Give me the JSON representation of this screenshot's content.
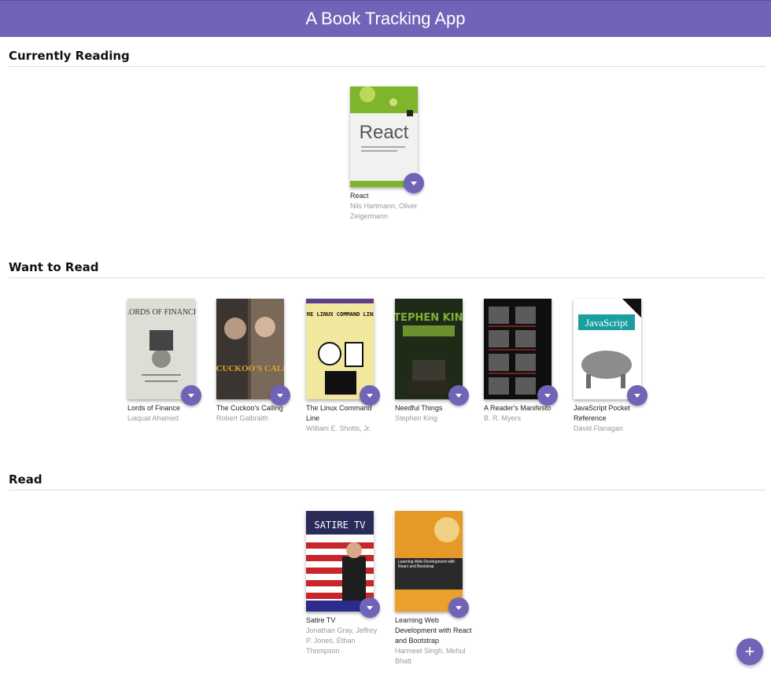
{
  "app": {
    "title": "A Book Tracking App"
  },
  "shelves": [
    {
      "title": "Currently Reading",
      "books": [
        {
          "title": "React",
          "authors": "Nils Hartmann, Oliver Zeigermann",
          "cover_text": "React"
        }
      ]
    },
    {
      "title": "Want to Read",
      "books": [
        {
          "title": "Lords of Finance",
          "authors": "Liaquat Ahamed",
          "cover_text": "LORDS OF FINANCE"
        },
        {
          "title": "The Cuckoo's Calling",
          "authors": "Robert Galbraith",
          "cover_text": "THE CUCKOO'S CALLING"
        },
        {
          "title": "The Linux Command Line",
          "authors": "William E. Shotts, Jr.",
          "cover_text": "THE LINUX COMMAND LINE"
        },
        {
          "title": "Needful Things",
          "authors": "Stephen King",
          "cover_text": "STEPHEN KING"
        },
        {
          "title": "A Reader's Manifesto",
          "authors": "B. R. Myers",
          "cover_text": ""
        },
        {
          "title": "JavaScript Pocket Reference",
          "authors": "David Flanagan",
          "cover_text": "JavaScript"
        }
      ]
    },
    {
      "title": "Read",
      "books": [
        {
          "title": "Satire TV",
          "authors": "Jonathan Gray, Jeffrey P. Jones, Ethan Thompson",
          "cover_text": "SATIRE TV"
        },
        {
          "title": "Learning Web Development with React and Bootstrap",
          "authors": "Harmeet Singh, Mehul Bhatt",
          "cover_text": "Learning Web Development with React and Bootstrap"
        }
      ]
    }
  ],
  "icons": {
    "shelf_changer": "caret-down-icon",
    "add": "plus-icon"
  },
  "add_button": {
    "label": "+"
  },
  "colors": {
    "accent": "#6f64b7"
  }
}
